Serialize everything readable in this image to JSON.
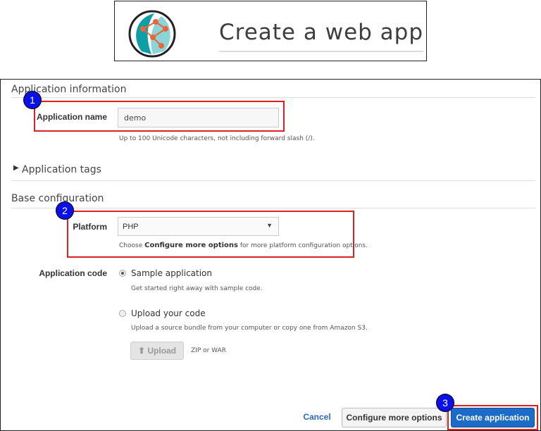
{
  "banner": {
    "title": "Create a web app"
  },
  "sections": {
    "app_info_title": "Application information",
    "tags_title": "Application tags",
    "base_title": "Base configuration"
  },
  "app_name": {
    "label": "Application name",
    "value": "demo",
    "help": "Up to 100 Unicode characters, not including forward slash (/)."
  },
  "platform": {
    "label": "Platform",
    "value": "PHP",
    "help_prefix": "Choose",
    "help_link": "Configure more options",
    "help_suffix": "for more platform configuration options."
  },
  "app_code": {
    "label": "Application code",
    "sample_label": "Sample application",
    "sample_help": "Get started right away with sample code.",
    "upload_label": "Upload your code",
    "upload_help": "Upload a source bundle from your computer or copy one from Amazon S3.",
    "upload_button": "Upload",
    "upload_formats": "ZIP or WAR",
    "selected": "sample"
  },
  "footer": {
    "cancel": "Cancel",
    "configure": "Configure more options",
    "create": "Create application"
  },
  "badges": [
    "1",
    "2",
    "3"
  ],
  "colors": {
    "highlight": "#e02020",
    "badge": "#0a10e6",
    "primary": "#1b6bc7"
  }
}
